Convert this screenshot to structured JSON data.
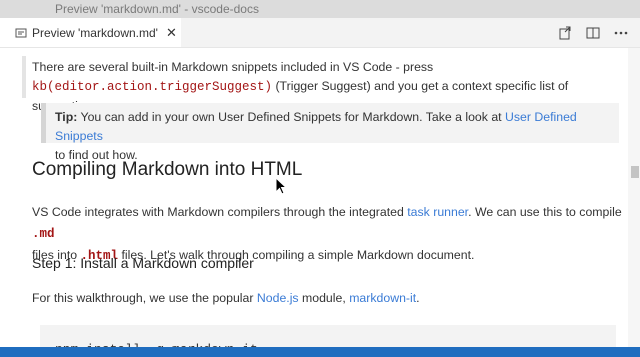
{
  "window": {
    "title": "Preview 'markdown.md' - vscode-docs"
  },
  "tab": {
    "label": "Preview 'markdown.md'",
    "close_glyph": "✕"
  },
  "toolbar": {
    "icons": [
      "open-source-icon",
      "split-editor-icon",
      "more-icon"
    ]
  },
  "content": {
    "intro_line1": "There are several built-in Markdown snippets included in VS Code - press",
    "intro_code": "kb(editor.action.triggerSuggest)",
    "intro_line2": " (Trigger Suggest) and you get a context specific list of suggestions.",
    "tip_label": "Tip:",
    "tip_text1": " You can add in your own User Defined Snippets for Markdown. Take a look at ",
    "tip_link": "User Defined Snippets",
    "tip_text2": "to find out how.",
    "heading": "Compiling Markdown into HTML",
    "p2_text1": "VS Code integrates with Markdown compilers through the integrated ",
    "p2_link": "task runner",
    "p2_text2": ". We can use this to compile ",
    "p2_code1": ".md",
    "p2_text3": "files into ",
    "p2_code2": ".html",
    "p2_text4": " files. Let's walk through compiling a simple Markdown document.",
    "step1": "Step 1: Install a Markdown compiler",
    "p3_text1": "For this walkthrough, we use the popular ",
    "p3_link1": "Node.js",
    "p3_text2": " module, ",
    "p3_link2": "markdown-it",
    "p3_text3": ".",
    "code_block": "npm install -g markdown-it"
  },
  "colors": {
    "link": "#3a7bd5",
    "code": "#a31515",
    "statusbar": "#1f6dbf"
  }
}
